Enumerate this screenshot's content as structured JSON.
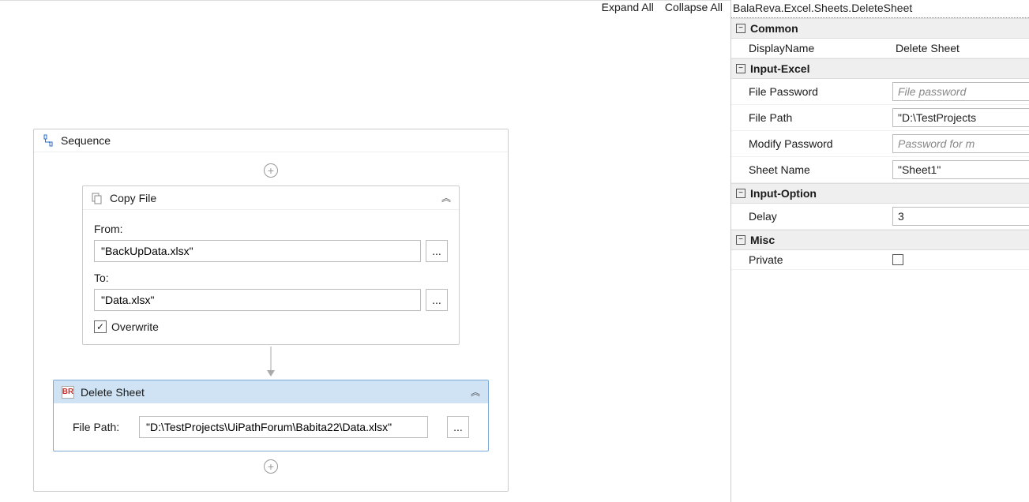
{
  "toolbar": {
    "expand_all": "Expand All",
    "collapse_all": "Collapse All"
  },
  "sequence": {
    "title": "Sequence",
    "copy_file": {
      "title": "Copy File",
      "from_label": "From:",
      "from_value": "\"BackUpData.xlsx\"",
      "to_label": "To:",
      "to_value": "\"Data.xlsx\"",
      "overwrite_label": "Overwrite",
      "overwrite_checked": true
    },
    "delete_sheet": {
      "title": "Delete Sheet",
      "filepath_label": "File Path:",
      "filepath_value": "\"D:\\TestProjects\\UiPathForum\\Babita22\\Data.xlsx\""
    }
  },
  "props": {
    "breadcrumb": "BalaReva.Excel.Sheets.DeleteSheet",
    "categories": {
      "common": {
        "label": "Common",
        "display_name_label": "DisplayName",
        "display_name_value": "Delete Sheet"
      },
      "input_excel": {
        "label": "Input-Excel",
        "file_password_label": "File Password",
        "file_password_placeholder": "File password",
        "file_path_label": "File Path",
        "file_path_value": "\"D:\\TestProjects",
        "modify_password_label": "Modify Password",
        "modify_password_placeholder": "Password for m",
        "sheet_name_label": "Sheet Name",
        "sheet_name_value": "\"Sheet1\""
      },
      "input_option": {
        "label": "Input-Option",
        "delay_label": "Delay",
        "delay_value": "3"
      },
      "misc": {
        "label": "Misc",
        "private_label": "Private",
        "private_checked": false
      }
    }
  }
}
